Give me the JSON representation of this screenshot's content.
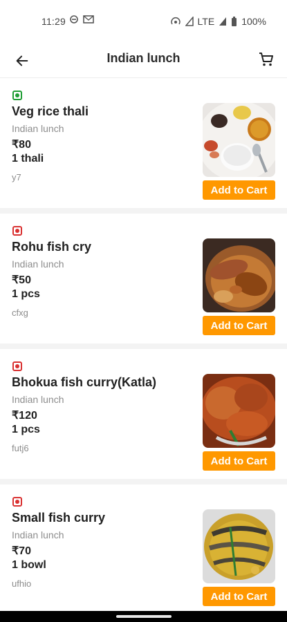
{
  "status": {
    "time": "11:29",
    "network": "LTE",
    "battery": "100%"
  },
  "header": {
    "title": "Indian lunch"
  },
  "items": [
    {
      "diet": "veg",
      "name": "Veg rice thali",
      "category": "Indian lunch",
      "price": "₹80",
      "quantity": "1 thali",
      "code": "y7",
      "button": "Add to Cart"
    },
    {
      "diet": "nonveg",
      "name": "Rohu fish cry",
      "category": "Indian lunch",
      "price": "₹50",
      "quantity": "1 pcs",
      "code": "cfxg",
      "button": "Add to Cart"
    },
    {
      "diet": "nonveg",
      "name": "Bhokua fish curry(Katla)",
      "category": "Indian lunch",
      "price": "₹120",
      "quantity": "1 pcs",
      "code": "futj6",
      "button": "Add to Cart"
    },
    {
      "diet": "nonveg",
      "name": "Small fish curry",
      "category": "Indian lunch",
      "price": "₹70",
      "quantity": "1 bowl",
      "code": "ufhio",
      "button": "Add to Cart"
    }
  ],
  "colors": {
    "accent": "#ff9800",
    "veg": "#1f9d34",
    "nonveg": "#d93131"
  },
  "icons": {
    "back": "arrow-left-icon",
    "cart": "shopping-cart-icon"
  }
}
